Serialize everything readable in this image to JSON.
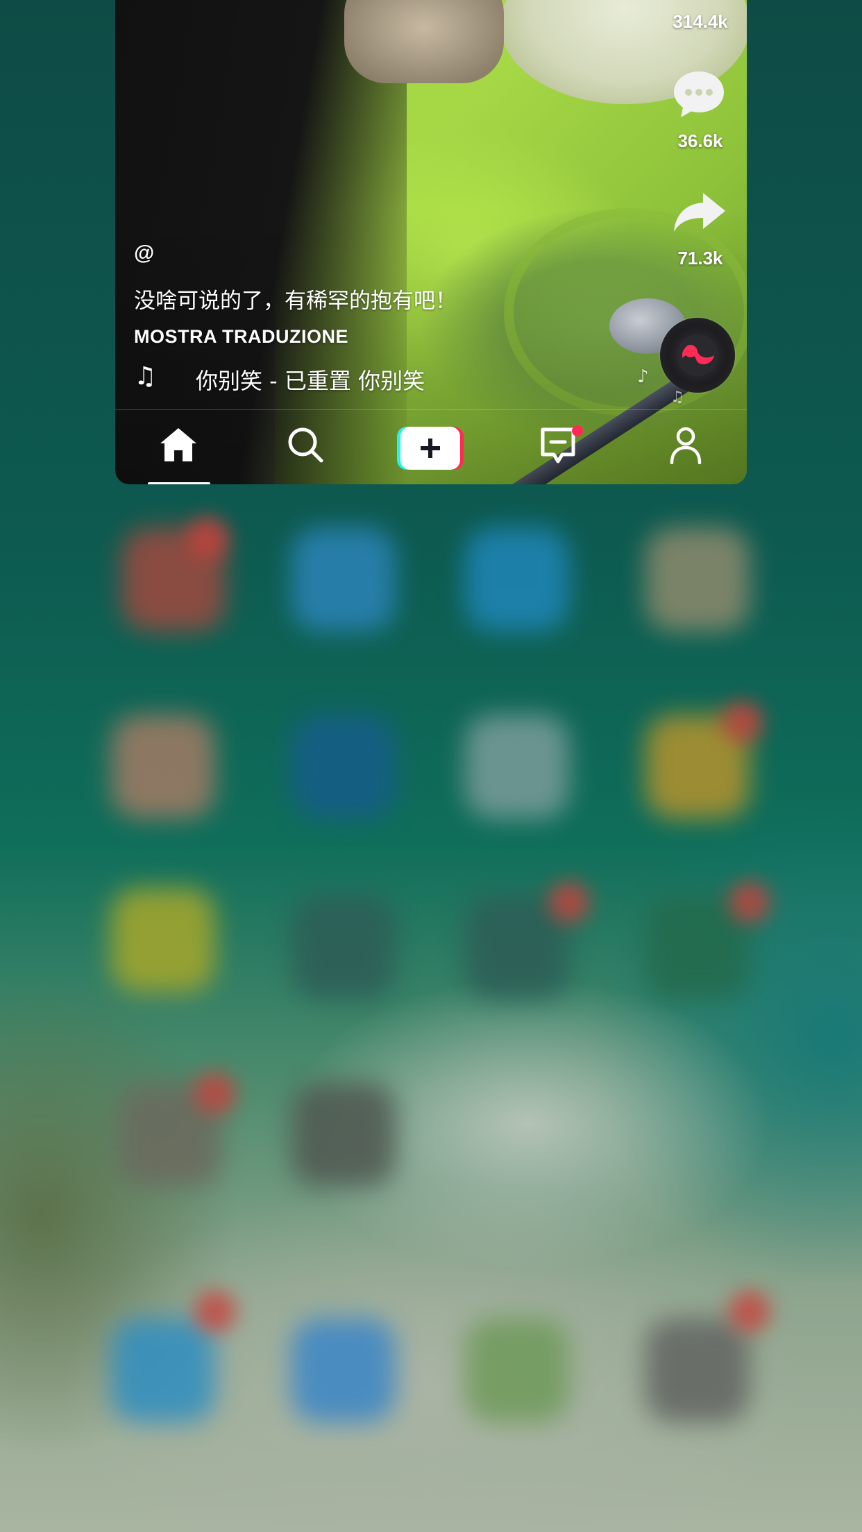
{
  "video": {
    "username": "@",
    "caption": "没啥可说的了，有稀罕的抱有吧！",
    "translate_label": "MOSTRA TRADUZIONE",
    "music_title": "你别笑 - 已重置    你别笑"
  },
  "actions": {
    "likes_count": "314.4k",
    "comments_count": "36.6k",
    "shares_count": "71.3k"
  },
  "tab_bar": {
    "home_icon": "home-icon",
    "search_icon": "search-icon",
    "create_icon": "plus-icon",
    "inbox_icon": "message-icon",
    "profile_icon": "person-icon",
    "inbox_has_badge": true
  },
  "colors": {
    "accent_red": "#fe2c55",
    "accent_cyan": "#25f4ee",
    "text": "#ffffff"
  }
}
